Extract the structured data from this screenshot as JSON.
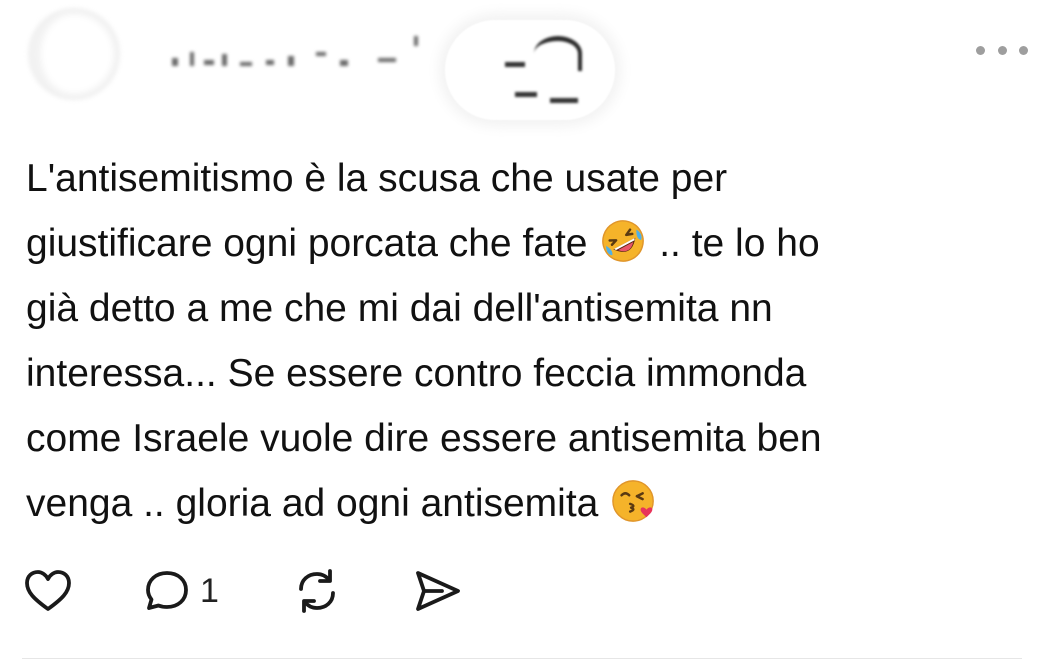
{
  "post": {
    "author_name": "",
    "text_lines": [
      "L'antisemitismo è la scusa che usate per",
      "giustificare ogni porcata che fate",
      " .. te lo ho",
      "già detto a me che mi dai dell'antisemita nn",
      "interessa... Se essere contro feccia immonda",
      "come Israele vuole dire essere antisemita ben",
      "venga .. gloria ad ogni antisemita"
    ],
    "emojis": {
      "laughing": "rolling-on-floor-laughing-emoji",
      "kiss": "face-blowing-kiss-emoji"
    }
  },
  "actions": {
    "like_icon": "heart-icon",
    "reply_icon": "comment-icon",
    "reply_count": "1",
    "repost_icon": "repost-icon",
    "share_icon": "send-icon"
  },
  "menu": {
    "icon": "more-icon"
  },
  "colors": {
    "text": "#111111",
    "icon": "#1a1a1a",
    "muted": "#9e9e9e",
    "divider": "#e6e6e6",
    "laugh_emoji": "#f5a623",
    "kiss_heart": "#e8345a"
  }
}
